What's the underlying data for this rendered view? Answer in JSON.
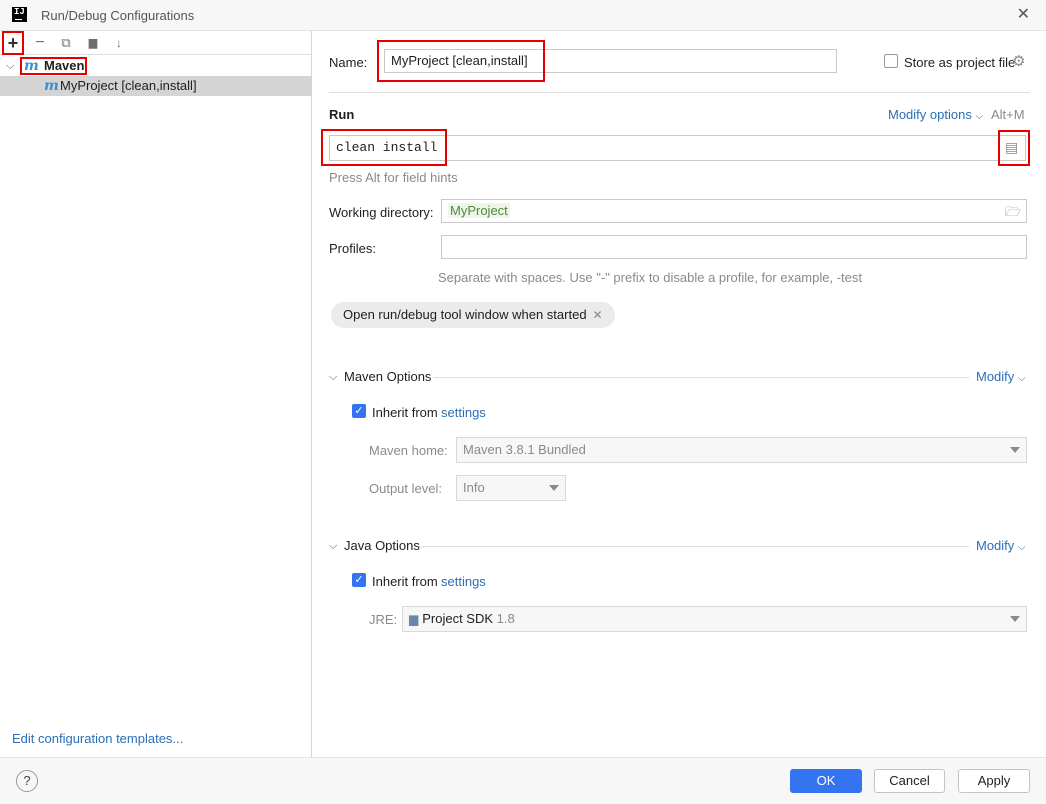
{
  "window": {
    "title": "Run/Debug Configurations",
    "app_icon_text": "IJ"
  },
  "left": {
    "toolbar": {
      "add": "+",
      "remove": "−",
      "copy": "⧉",
      "folder": "▆",
      "sort": "↓"
    },
    "tree": [
      {
        "label": "Maven",
        "icon_letter": "m"
      },
      {
        "label": "MyProject [clean,install]",
        "icon_letter": "m"
      }
    ],
    "edit_templates_link": "Edit configuration templates..."
  },
  "form": {
    "name_label": "Name:",
    "name_value": "MyProject [clean,install]",
    "store_label": "Store as project file",
    "run_heading": "Run",
    "modify_options_label": "Modify options",
    "modify_options_shortcut": "Alt+M",
    "run_command_value": "clean install",
    "field_hint": "Press Alt for field hints",
    "working_dir_label": "Working directory:",
    "working_dir_value": "MyProject",
    "profiles_label": "Profiles:",
    "profiles_value": "",
    "profiles_hint": "Separate with spaces. Use \"-\" prefix to disable a profile, for example, -test",
    "chip_label": "Open run/debug tool window when started",
    "maven_options": {
      "title": "Maven Options",
      "modify_label": "Modify",
      "inherit_label": "Inherit from",
      "inherit_link": "settings",
      "maven_home_label": "Maven home:",
      "maven_home_value": "Maven 3.8.1 Bundled",
      "output_level_label": "Output level:",
      "output_level_value": "Info"
    },
    "java_options": {
      "title": "Java Options",
      "modify_label": "Modify",
      "inherit_label": "Inherit from",
      "inherit_link": "settings",
      "jre_label": "JRE:",
      "jre_value": "Project SDK",
      "jre_version": "1.8"
    }
  },
  "footer": {
    "help": "?",
    "ok": "OK",
    "cancel": "Cancel",
    "apply": "Apply"
  },
  "colors": {
    "accent": "#3574f0",
    "link": "#2a6fb7",
    "highlight": "#e60000",
    "selection": "#d4d4d4"
  }
}
